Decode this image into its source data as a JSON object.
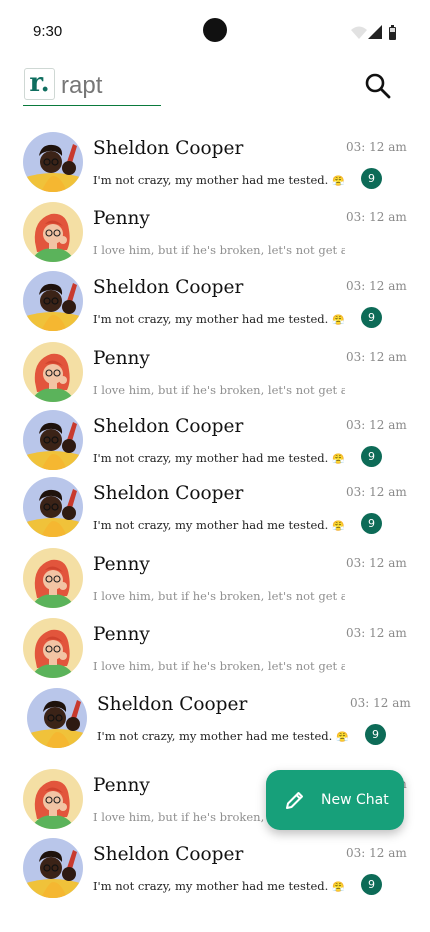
{
  "status_bar": {
    "time": "9:30"
  },
  "header": {
    "logo_letter": "r.",
    "app_name": "rapt"
  },
  "chats": [
    {
      "name": "Sheldon Cooper",
      "time": "03: 12 am",
      "preview": "I'm not crazy, my mother had me tested.",
      "emoji": "😤",
      "unread": "9",
      "avatar": "sheldon"
    },
    {
      "name": "Penny",
      "time": "03: 12 am",
      "preview": "I love him, but if he's broken, let's not get a",
      "avatar": "penny"
    },
    {
      "name": "Sheldon Cooper",
      "time": "03: 12 am",
      "preview": "I'm not crazy, my mother had me tested.",
      "emoji": "😤",
      "unread": "9",
      "avatar": "sheldon"
    },
    {
      "name": "Penny",
      "time": "03: 12 am",
      "preview": "I love him, but if he's broken, let's not get a",
      "avatar": "penny"
    },
    {
      "name": "Sheldon Cooper",
      "time": "03: 12 am",
      "preview": "I'm not crazy, my mother had me tested.",
      "emoji": "😤",
      "unread": "9",
      "avatar": "sheldon"
    },
    {
      "name": "Sheldon Cooper",
      "time": "03: 12 am",
      "preview": "I'm not crazy, my mother had me tested.",
      "emoji": "😤",
      "unread": "9",
      "avatar": "sheldon"
    },
    {
      "name": "Penny",
      "time": "03: 12 am",
      "preview": "I love him, but if he's broken, let's not get a",
      "avatar": "penny"
    },
    {
      "name": "Penny",
      "time": "03: 12 am",
      "preview": "I love him, but if he's broken, let's not get a",
      "avatar": "penny"
    },
    {
      "name": "Sheldon Cooper",
      "time": "03: 12 am",
      "preview": "I'm not crazy, my mother had me tested.",
      "emoji": "😤",
      "unread": "9",
      "avatar": "sheldon"
    },
    {
      "name": "Penny",
      "time": "03: 12 am",
      "preview": "I love him, but if he's broken, let's not get a",
      "avatar": "penny"
    },
    {
      "name": "Sheldon Cooper",
      "time": "03: 12 am",
      "preview": "I'm not crazy, my mother had me tested.",
      "emoji": "😤",
      "unread": "9",
      "avatar": "sheldon"
    }
  ],
  "fab": {
    "label": "New Chat",
    "icon": "pencil-icon"
  },
  "colors": {
    "accent": "#17a07a",
    "badge": "#0d6b57",
    "logo": "#0f6e5f"
  }
}
